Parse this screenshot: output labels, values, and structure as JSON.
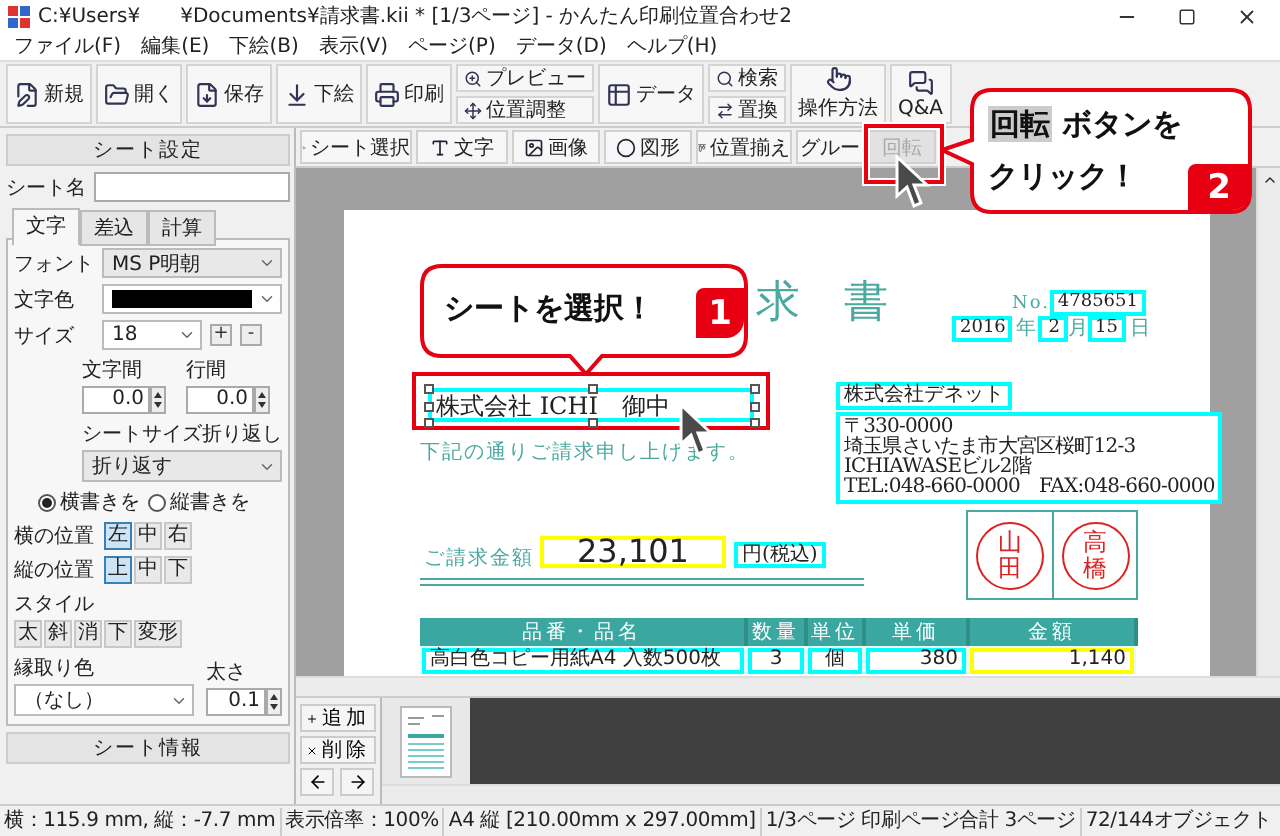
{
  "window": {
    "title": "C:¥Users¥　　¥Documents¥請求書.kii * [1/3ページ] - かんたん印刷位置合わせ2"
  },
  "menu": [
    "ファイル(F)",
    "編集(E)",
    "下絵(B)",
    "表示(V)",
    "ページ(P)",
    "データ(D)",
    "ヘルプ(H)"
  ],
  "toolbar": [
    {
      "kind": "large",
      "label": "新規"
    },
    {
      "kind": "large",
      "label": "開く"
    },
    {
      "kind": "large",
      "label": "保存"
    },
    {
      "kind": "large",
      "label": "下絵"
    },
    {
      "kind": "large",
      "label": "印刷"
    },
    {
      "kind": "pair",
      "labels": [
        "プレビュー",
        "位置調整"
      ]
    },
    {
      "kind": "large",
      "label": "データ"
    },
    {
      "kind": "pair",
      "labels": [
        "検索",
        "置換"
      ]
    },
    {
      "kind": "tall",
      "label": "操作方法"
    },
    {
      "kind": "tall",
      "label": "Q&A"
    }
  ],
  "sheet_panel": {
    "title": "シート設定",
    "name_label": "シート名",
    "tabs": [
      {
        "label": "文字",
        "selected": true
      },
      {
        "label": "差込",
        "selected": false
      },
      {
        "label": "計算",
        "selected": false
      }
    ],
    "font": {
      "label": "フォント",
      "value": "MS P明朝"
    },
    "text_color": {
      "label": "文字色"
    },
    "size": {
      "label": "サイズ",
      "value": "18",
      "plus": "+",
      "minus": "-"
    },
    "char_spacing": {
      "label": "文字間",
      "value": "0.0"
    },
    "line_spacing": {
      "label": "行間",
      "value": "0.0"
    },
    "wrap": {
      "label": "シートサイズ折り返し",
      "value": "折り返す"
    },
    "direction": [
      {
        "label": "横書きを",
        "selected": true
      },
      {
        "label": "縦書きを",
        "selected": false
      }
    ],
    "h_align": {
      "label": "横の位置",
      "options": [
        {
          "label": "左",
          "selected": true
        },
        {
          "label": "中",
          "selected": false
        },
        {
          "label": "右",
          "selected": false
        }
      ]
    },
    "v_align": {
      "label": "縦の位置",
      "options": [
        {
          "label": "上",
          "selected": true
        },
        {
          "label": "中",
          "selected": false
        },
        {
          "label": "下",
          "selected": false
        }
      ]
    },
    "style": {
      "label": "スタイル",
      "buttons": [
        "太",
        "斜",
        "消",
        "下",
        "変形"
      ]
    },
    "outline_color": {
      "label": "縁取り色",
      "value": "（なし）"
    },
    "thickness": {
      "label": "太さ",
      "value": "0.1"
    },
    "info_title": "シート情報"
  },
  "sheet_tools": [
    {
      "label": "シート選択",
      "disabled": false
    },
    {
      "label": "文字",
      "disabled": false
    },
    {
      "label": "画像",
      "disabled": false
    },
    {
      "label": "図形",
      "disabled": false
    },
    {
      "label": "位置揃え",
      "disabled": false
    },
    {
      "label": "グルー",
      "disabled": false
    },
    {
      "label": "回転",
      "disabled": true
    }
  ],
  "document": {
    "title": "求　書",
    "no_label": "No.",
    "no": {
      "text": "4785651",
      "color": "#00ffff"
    },
    "year": {
      "text": "2016",
      "color": "#00ffff"
    },
    "year_unit": "年",
    "month": {
      "text": "2",
      "color": "#00ffff"
    },
    "month_unit": "月",
    "day": {
      "text": "15",
      "color": "#00ffff"
    },
    "day_unit": "日",
    "recipient": {
      "text": "株式会社 ICHI　御中",
      "color": "#00ffff",
      "selected": true
    },
    "note": "下記の通りご請求申し上げます。",
    "issuer": {
      "text": "株式会社デネット",
      "color": "#00ffff"
    },
    "address": {
      "lines": [
        "〒330-0000",
        "埼玉県さいたま市大宮区桜町12-3",
        "ICHIAWASEビル2階",
        "TEL:048-660-0000　FAX:048-660-0000"
      ],
      "color": "#00ffff"
    },
    "stamps": [
      "山田",
      "高橋"
    ],
    "amount_label": "ご請求金額",
    "amount": {
      "text": "23,101",
      "color": "#ffff00"
    },
    "amount_unit": {
      "text": "円(税込)",
      "color": "#00ffff"
    },
    "table": {
      "columns": [
        "品番・品名",
        "数量",
        "単位",
        "単価",
        "金額"
      ],
      "rows": [
        {
          "cells": [
            {
              "text": "高白色コピー用紙A4 入数500枚",
              "color": "#00ffff"
            },
            {
              "text": "3",
              "color": "#00ffff"
            },
            {
              "text": "個",
              "color": "#00ffff"
            },
            {
              "text": "380",
              "color": "#00ffff"
            },
            {
              "text": "1,140",
              "color": "#ffff00"
            }
          ]
        }
      ]
    }
  },
  "callout_1": {
    "text": "シートを選択！",
    "number": "1"
  },
  "callout_2": {
    "highlight": "回転",
    "text": "ボタンを",
    "line2": "クリック！",
    "number": "2"
  },
  "pages_panel": {
    "buttons": [
      "追加",
      "削除"
    ]
  },
  "status_bar": [
    "横：115.9 mm, 縦：-7.7 mm",
    "表示倍率：100%",
    "A4 縦 [210.00mm x 297.00mm]",
    "1/3ページ 印刷ページ合計 3ページ",
    "72/144オブジェクト"
  ]
}
